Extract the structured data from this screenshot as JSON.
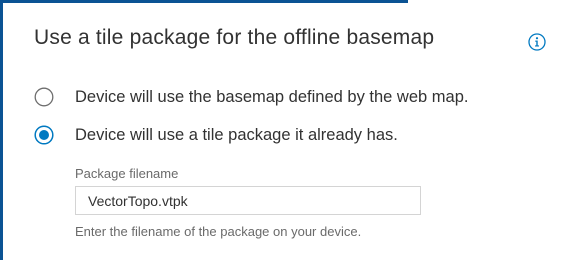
{
  "section": {
    "title": "Use a tile package for the offline basemap",
    "info_icon": "info-icon"
  },
  "basemap_options": [
    {
      "label": "Device will use the basemap defined by the web map.",
      "selected": false
    },
    {
      "label": "Device will use a tile package it already has.",
      "selected": true
    }
  ],
  "package_field": {
    "label": "Package filename",
    "value": "VectorTopo.vtpk",
    "hint": "Enter the filename of the package on your device."
  },
  "colors": {
    "accent": "#0b5394",
    "radio_selected": "#0079c1",
    "text": "#323232",
    "secondary_text": "#6a6a6a",
    "input_border": "#d4d4d4"
  }
}
